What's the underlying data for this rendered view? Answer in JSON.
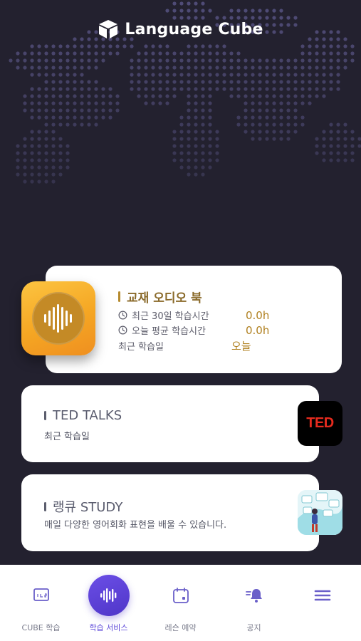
{
  "app": {
    "title": "Language Cube"
  },
  "audio_book": {
    "title": "교재 오디오 북",
    "stats": [
      {
        "label": "최근 30일 학습시간",
        "value": "0.0h"
      },
      {
        "label": "오늘 평균 학습시간",
        "value": "0.0h"
      },
      {
        "label": "최근 학습일",
        "value": "오늘"
      }
    ]
  },
  "ted": {
    "title": "TED TALKS",
    "subtitle": "최근 학습일",
    "logo_text": "TED"
  },
  "study": {
    "title": "랭큐 STUDY",
    "subtitle": "매일 다양한 영어회화 표현을 배울 수 있습니다."
  },
  "tabs": [
    {
      "label": "CUBE 학습",
      "icon": "cube-learning-icon",
      "active": false
    },
    {
      "label": "학습 서비스",
      "icon": "audio-wave-icon",
      "active": true
    },
    {
      "label": "레슨 예약",
      "icon": "calendar-icon",
      "active": false
    },
    {
      "label": "공지",
      "icon": "bell-icon",
      "active": false
    },
    {
      "label": "",
      "icon": "menu-icon",
      "active": false
    }
  ],
  "colors": {
    "background": "#23212f",
    "accent": "#5b46d8",
    "audio_gold": "#b08020",
    "ted_red": "#e62b1e"
  }
}
